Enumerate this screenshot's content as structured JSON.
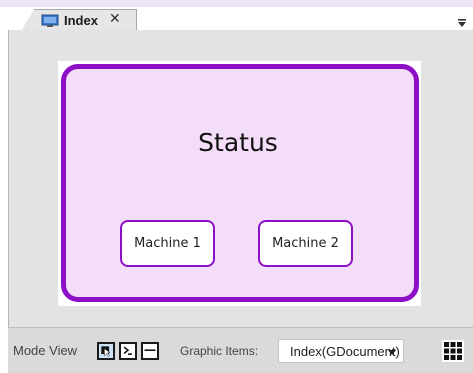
{
  "tab": {
    "label": "Index",
    "close_glyph": "✕",
    "icon": "monitor-icon"
  },
  "canvas": {
    "title": "Status",
    "machines": [
      "Machine 1",
      "Machine 2"
    ],
    "accent": "#8d10c7",
    "fill": "#f4ddf8"
  },
  "toolbar": {
    "mode_label": "Mode View",
    "tools": [
      "select-mode-icon",
      "command-mode-icon",
      "line-mode-icon"
    ],
    "graphic_items_label": "Graphic Items:",
    "graphic_items_value": "Index(GDocument)",
    "grid_icon": "grid-icon"
  }
}
